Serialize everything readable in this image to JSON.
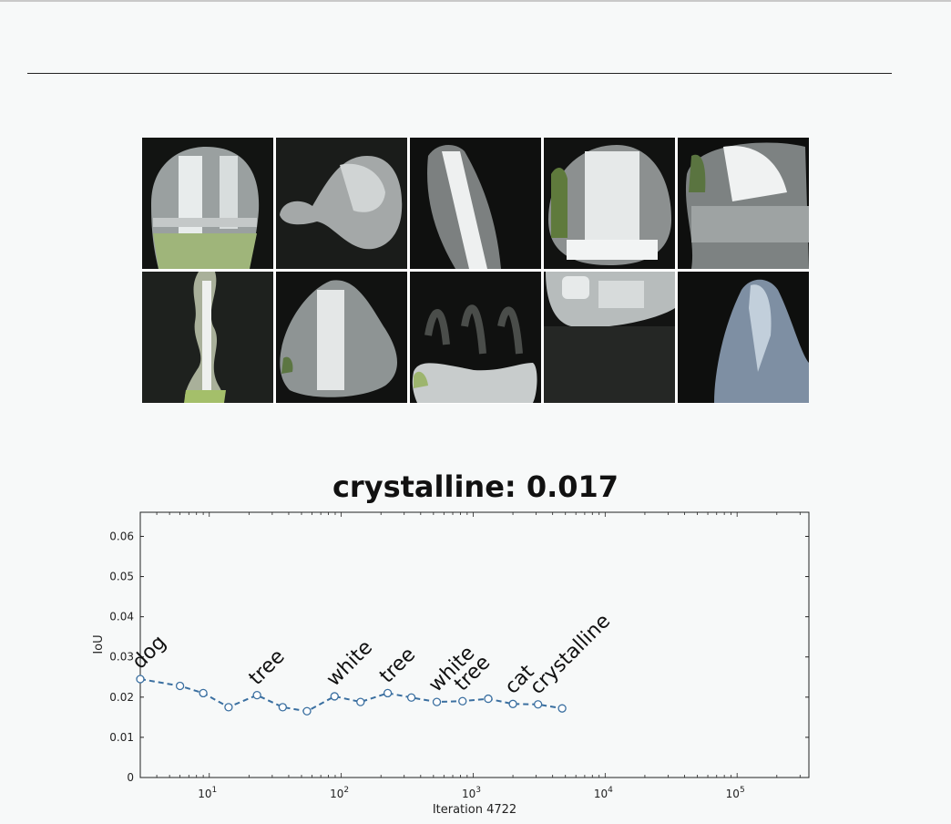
{
  "title": "crystalline: 0.017",
  "image_grid": {
    "rows": 2,
    "cols": 5
  },
  "chart_data": {
    "type": "line",
    "title": "crystalline: 0.017",
    "xlabel": "Iteration 4722",
    "ylabel": "IoU",
    "xscale": "log",
    "xlim": [
      3,
      350000
    ],
    "ylim": [
      0,
      0.066
    ],
    "yticks": [
      0,
      0.01,
      0.02,
      0.03,
      0.04,
      0.05,
      0.06
    ],
    "ytick_labels": [
      "0",
      "0.01",
      "0.02",
      "0.03",
      "0.04",
      "0.05",
      "0.06"
    ],
    "xtick_exponents": [
      1,
      2,
      3,
      4,
      5
    ],
    "xtick_base": "10",
    "grid": false,
    "series": [
      {
        "color": "#3a6fa0",
        "style": "dashed",
        "marker": "circle",
        "x": [
          3,
          6,
          9,
          14,
          23,
          36,
          55,
          89,
          140,
          225,
          340,
          530,
          830,
          1300,
          2000,
          3100,
          4722
        ],
        "y": [
          0.0245,
          0.0228,
          0.021,
          0.0175,
          0.0205,
          0.0175,
          0.0165,
          0.0202,
          0.0188,
          0.021,
          0.0199,
          0.0188,
          0.019,
          0.0196,
          0.0183,
          0.0182,
          0.0172
        ]
      }
    ],
    "annotations": [
      {
        "text": "dog",
        "x": 3,
        "y": 0.0245
      },
      {
        "text": "tree",
        "x": 23,
        "y": 0.0205
      },
      {
        "text": "white",
        "x": 89,
        "y": 0.0202
      },
      {
        "text": "tree",
        "x": 225,
        "y": 0.021
      },
      {
        "text": "white",
        "x": 530,
        "y": 0.0188
      },
      {
        "text": "tree",
        "x": 830,
        "y": 0.019
      },
      {
        "text": "cat",
        "x": 2000,
        "y": 0.0183
      },
      {
        "text": "crystalline",
        "x": 3100,
        "y": 0.0182
      }
    ]
  }
}
